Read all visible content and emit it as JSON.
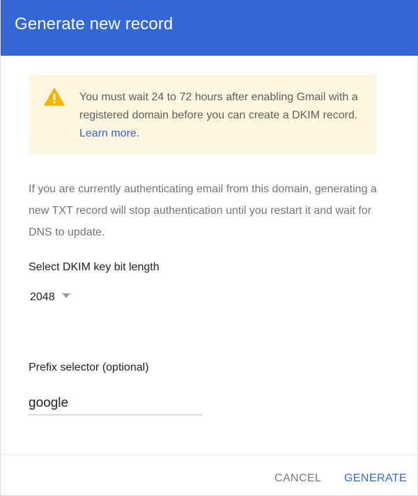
{
  "dialog": {
    "title": "Generate new record"
  },
  "warning": {
    "icon": "warning-icon",
    "icon_color": "#f4b400",
    "text": "You must wait 24 to 72 hours after enabling Gmail with a registered domain before you can create a DKIM record. ",
    "link_label": "Learn more."
  },
  "info": {
    "text": "If you are currently authenticating email from this domain, generating a new TXT record will stop authentication until you restart it and wait for DNS to update."
  },
  "key_length": {
    "label": "Select DKIM key bit length",
    "selected_value": "2048"
  },
  "prefix": {
    "label": "Prefix selector (optional)",
    "value": "google"
  },
  "footer": {
    "cancel_label": "CANCEL",
    "generate_label": "GENERATE"
  },
  "colors": {
    "header_bg": "#3367d6",
    "accent": "#3367d6",
    "warning_bg": "#fef6e0"
  }
}
